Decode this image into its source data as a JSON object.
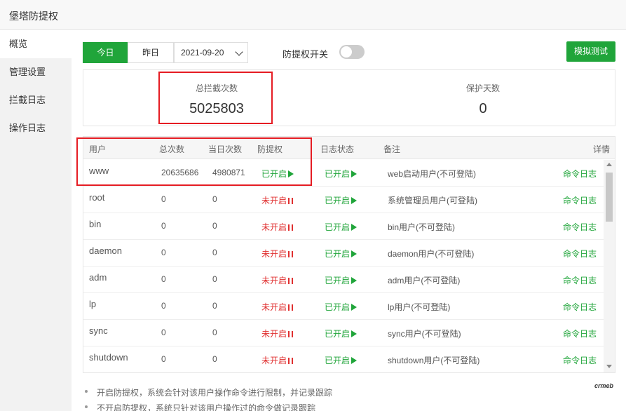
{
  "window": {
    "title": "堡塔防提权"
  },
  "sidebar": {
    "items": [
      {
        "label": "概览"
      },
      {
        "label": "管理设置"
      },
      {
        "label": "拦截日志"
      },
      {
        "label": "操作日志"
      }
    ]
  },
  "toolbar": {
    "today_label": "今日",
    "yesterday_label": "昨日",
    "date_value": "2021-09-20",
    "switch_label": "防提权开关",
    "switch_on": false,
    "test_button": "模拟测试"
  },
  "stats": {
    "total_label": "总拦截次数",
    "total_value": "5025803",
    "days_label": "保护天数",
    "days_value": "0"
  },
  "table": {
    "headers": {
      "user": "用户",
      "total": "总次数",
      "today": "当日次数",
      "protect": "防提权",
      "log_status": "日志状态",
      "remark": "备注",
      "detail": "详情"
    },
    "rows": [
      {
        "user": "www",
        "total": "20635686",
        "today": "4980871",
        "protect": "已开启",
        "protect_on": true,
        "log": "已开启",
        "remark": "web启动用户(不可登陆)",
        "detail": "命令日志"
      },
      {
        "user": "root",
        "total": "0",
        "today": "0",
        "protect": "未开启",
        "protect_on": false,
        "log": "已开启",
        "remark": "系统管理员用户(可登陆)",
        "detail": "命令日志"
      },
      {
        "user": "bin",
        "total": "0",
        "today": "0",
        "protect": "未开启",
        "protect_on": false,
        "log": "已开启",
        "remark": "bin用户(不可登陆)",
        "detail": "命令日志"
      },
      {
        "user": "daemon",
        "total": "0",
        "today": "0",
        "protect": "未开启",
        "protect_on": false,
        "log": "已开启",
        "remark": "daemon用户(不可登陆)",
        "detail": "命令日志"
      },
      {
        "user": "adm",
        "total": "0",
        "today": "0",
        "protect": "未开启",
        "protect_on": false,
        "log": "已开启",
        "remark": "adm用户(不可登陆)",
        "detail": "命令日志"
      },
      {
        "user": "lp",
        "total": "0",
        "today": "0",
        "protect": "未开启",
        "protect_on": false,
        "log": "已开启",
        "remark": "lp用户(不可登陆)",
        "detail": "命令日志"
      },
      {
        "user": "sync",
        "total": "0",
        "today": "0",
        "protect": "未开启",
        "protect_on": false,
        "log": "已开启",
        "remark": "sync用户(不可登陆)",
        "detail": "命令日志"
      },
      {
        "user": "shutdown",
        "total": "0",
        "today": "0",
        "protect": "未开启",
        "protect_on": false,
        "log": "已开启",
        "remark": "shutdown用户(不可登陆)",
        "detail": "命令日志"
      }
    ]
  },
  "notes": [
    "开启防提权，系统会针对该用户操作命令进行限制，并记录跟踪",
    "不开启防提权，系统只针对该用户操作过的命令做记录跟踪"
  ],
  "watermark": "crmeb",
  "colors": {
    "accent": "#20a53a",
    "off": "#e03030",
    "highlight": "#e51c23"
  }
}
